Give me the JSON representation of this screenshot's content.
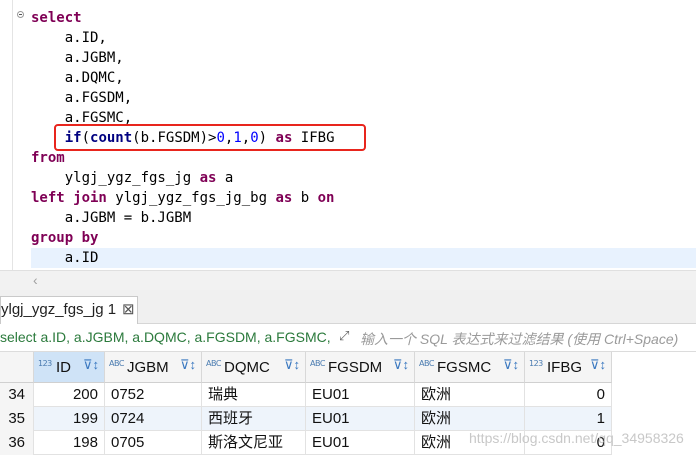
{
  "editor": {
    "lines": [
      {
        "parts": [
          {
            "t": "select",
            "c": "kw"
          }
        ]
      },
      {
        "parts": [
          {
            "t": "    a.ID,",
            "c": ""
          }
        ]
      },
      {
        "parts": [
          {
            "t": "    a.JGBM,",
            "c": ""
          }
        ]
      },
      {
        "parts": [
          {
            "t": "    a.DQMC,",
            "c": ""
          }
        ]
      },
      {
        "parts": [
          {
            "t": "    a.FGSDM,",
            "c": ""
          }
        ]
      },
      {
        "parts": [
          {
            "t": "    a.FGSMC,",
            "c": ""
          }
        ]
      },
      {
        "parts": [
          {
            "t": "    ",
            "c": ""
          },
          {
            "t": "if",
            "c": "fn"
          },
          {
            "t": "(",
            "c": ""
          },
          {
            "t": "count",
            "c": "fn"
          },
          {
            "t": "(b.FGSDM)>",
            "c": ""
          },
          {
            "t": "0",
            "c": "num"
          },
          {
            "t": ",",
            "c": ""
          },
          {
            "t": "1",
            "c": "num"
          },
          {
            "t": ",",
            "c": ""
          },
          {
            "t": "0",
            "c": "num"
          },
          {
            "t": ") ",
            "c": ""
          },
          {
            "t": "as",
            "c": "kw"
          },
          {
            "t": " IFBG",
            "c": ""
          }
        ]
      },
      {
        "parts": [
          {
            "t": "from",
            "c": "kw"
          }
        ]
      },
      {
        "parts": [
          {
            "t": "    ylgj_ygz_fgs_jg ",
            "c": ""
          },
          {
            "t": "as",
            "c": "kw"
          },
          {
            "t": " a",
            "c": ""
          }
        ]
      },
      {
        "parts": [
          {
            "t": "left join",
            "c": "kw"
          },
          {
            "t": " ylgj_ygz_fgs_jg_bg ",
            "c": ""
          },
          {
            "t": "as",
            "c": "kw"
          },
          {
            "t": " b ",
            "c": ""
          },
          {
            "t": "on",
            "c": "kw"
          }
        ]
      },
      {
        "parts": [
          {
            "t": "    a.JGBM = b.JGBM",
            "c": ""
          }
        ]
      },
      {
        "parts": [
          {
            "t": "group by",
            "c": "kw"
          }
        ]
      },
      {
        "parts": [
          {
            "t": "    a.ID",
            "c": ""
          }
        ],
        "current": true
      }
    ]
  },
  "result_tab": {
    "label": "ylgj_ygz_fgs_jg 1",
    "close": "⊠"
  },
  "filter": {
    "sql_text": "select a.ID, a.JGBM, a.DQMC, a.FGSDM, a.FGSMC, if",
    "placeholder": "输入一个 SQL 表达式来过滤结果 (使用 Ctrl+Space)"
  },
  "grid": {
    "columns": [
      {
        "key": "ID",
        "label": "ID",
        "type_icon": "123",
        "selected": true
      },
      {
        "key": "JGBM",
        "label": "JGBM",
        "type_icon": "ABC"
      },
      {
        "key": "DQMC",
        "label": "DQMC",
        "type_icon": "ABC"
      },
      {
        "key": "FGSDM",
        "label": "FGSDM",
        "type_icon": "ABC"
      },
      {
        "key": "FGSMC",
        "label": "FGSMC",
        "type_icon": "ABC"
      },
      {
        "key": "IFBG",
        "label": "IFBG",
        "type_icon": "123"
      }
    ],
    "rows": [
      {
        "rownum": "34",
        "ID": "200",
        "JGBM": "0752",
        "DQMC": "瑞典",
        "FGSDM": "EU01",
        "FGSMC": "欧洲",
        "IFBG": "0"
      },
      {
        "rownum": "35",
        "ID": "199",
        "JGBM": "0724",
        "DQMC": "西班牙",
        "FGSDM": "EU01",
        "FGSMC": "欧洲",
        "IFBG": "1"
      },
      {
        "rownum": "36",
        "ID": "198",
        "JGBM": "0705",
        "DQMC": "斯洛文尼亚",
        "FGSDM": "EU01",
        "FGSMC": "欧洲",
        "IFBG": "0"
      }
    ]
  },
  "watermark": "https://blog.csdn.net/qq_34958326",
  "colors": {
    "keyword": "#7f0055",
    "number": "#0000ff",
    "highlight_box": "#e8251d",
    "selected_header": "#cfe3f7"
  }
}
